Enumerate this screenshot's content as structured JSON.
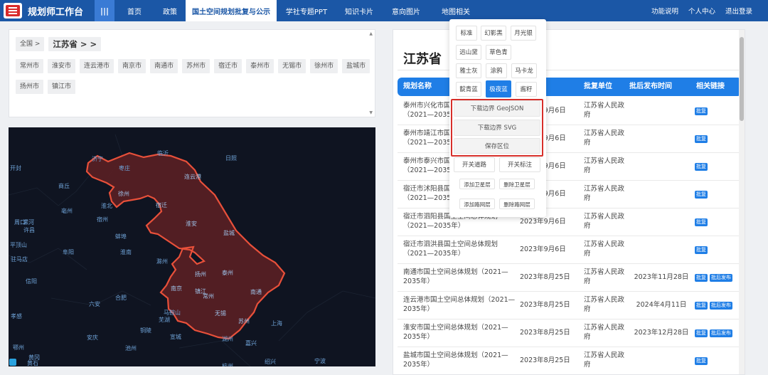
{
  "header": {
    "brand": "规划师工作台",
    "menu_toggle": "|||",
    "nav": [
      {
        "label": "首页",
        "active": false
      },
      {
        "label": "政策",
        "active": false
      },
      {
        "label": "国土空间规划批复与公示",
        "active": true
      },
      {
        "label": "学社专题PPT",
        "active": false
      },
      {
        "label": "知识卡片",
        "active": false
      },
      {
        "label": "意向图片",
        "active": false
      },
      {
        "label": "地图相关",
        "active": false
      }
    ],
    "right_links": [
      "功能说明",
      "个人中心",
      "退出登录"
    ]
  },
  "city_panel": {
    "crumb_all": "全国 >",
    "crumb_province": "江苏省 > >",
    "cities": [
      "常州市",
      "淮安市",
      "连云港市",
      "南京市",
      "南通市",
      "苏州市",
      "宿迁市",
      "泰州市",
      "无锡市",
      "徐州市",
      "盐城市",
      "扬州市",
      "镇江市"
    ]
  },
  "map": {
    "labels": [
      {
        "text": "济宁"
      },
      {
        "text": "临沂"
      },
      {
        "text": "枣庄"
      },
      {
        "text": "日照"
      },
      {
        "text": "开封"
      },
      {
        "text": "商丘"
      },
      {
        "text": "徐州"
      },
      {
        "text": "连云港"
      },
      {
        "text": "周口"
      },
      {
        "text": "亳州"
      },
      {
        "text": "淮北"
      },
      {
        "text": "宿州"
      },
      {
        "text": "宿迁"
      },
      {
        "text": "漯河"
      },
      {
        "text": "蚌埠"
      },
      {
        "text": "淮安"
      },
      {
        "text": "盐城"
      },
      {
        "text": "阜阳"
      },
      {
        "text": "淮南"
      },
      {
        "text": "滁州"
      },
      {
        "text": "扬州"
      },
      {
        "text": "泰州"
      },
      {
        "text": "信阳"
      },
      {
        "text": "六安"
      },
      {
        "text": "合肥"
      },
      {
        "text": "南京"
      },
      {
        "text": "镇江"
      },
      {
        "text": "常州"
      },
      {
        "text": "南通"
      },
      {
        "text": "马鞍山"
      },
      {
        "text": "芜湖"
      },
      {
        "text": "无锡"
      },
      {
        "text": "苏州"
      },
      {
        "text": "上海"
      },
      {
        "text": "安庆"
      },
      {
        "text": "铜陵"
      },
      {
        "text": "宣城"
      },
      {
        "text": "湖州"
      },
      {
        "text": "嘉兴"
      },
      {
        "text": "池州"
      },
      {
        "text": "黄冈"
      },
      {
        "text": "杭州"
      },
      {
        "text": "黄石"
      },
      {
        "text": "绍兴"
      },
      {
        "text": "鄂州"
      },
      {
        "text": "许昌"
      },
      {
        "text": "平顶山"
      },
      {
        "text": "驻马店"
      },
      {
        "text": "孝感"
      },
      {
        "text": "宁波"
      }
    ]
  },
  "detail": {
    "title": "江苏省",
    "columns": [
      "规划名称",
      "",
      "批复单位",
      "批后发布时间",
      "相关链接"
    ],
    "rows": [
      {
        "name": "泰州市兴化市国土空间总体规划（2021—2035年）",
        "date": "2023年9月6日",
        "unit": "江苏省人民政府",
        "pub": "",
        "links": [
          "批复"
        ]
      },
      {
        "name": "泰州市靖江市国土空间总体规划（2021—2035年）",
        "date": "2023年9月6日",
        "unit": "江苏省人民政府",
        "pub": "",
        "links": [
          "批复"
        ]
      },
      {
        "name": "泰州市泰兴市国土空间总体规划（2021—2035年）",
        "date": "2023年9月6日",
        "unit": "江苏省人民政府",
        "pub": "",
        "links": [
          "批复"
        ]
      },
      {
        "name": "宿迁市沭阳县国土空间总体规划（2021—2035年）",
        "date": "2023年9月6日",
        "unit": "江苏省人民政府",
        "pub": "",
        "links": [
          "批复"
        ]
      },
      {
        "name": "宿迁市泗阳县国土空间总体规划（2021—2035年）",
        "date": "2023年9月6日",
        "unit": "江苏省人民政府",
        "pub": "",
        "links": [
          "批复"
        ]
      },
      {
        "name": "宿迁市泗洪县国土空间总体规划（2021—2035年）",
        "date": "2023年9月6日",
        "unit": "江苏省人民政府",
        "pub": "",
        "links": [
          "批复"
        ]
      },
      {
        "name": "南通市国土空间总体规划（2021—2035年）",
        "date": "2023年8月25日",
        "unit": "江苏省人民政府",
        "pub": "2023年11月28日",
        "links": [
          "批复",
          "批后发布"
        ]
      },
      {
        "name": "连云港市国土空间总体规划（2021—2035年）",
        "date": "2023年8月25日",
        "unit": "江苏省人民政府",
        "pub": "2024年4月11日",
        "links": [
          "批复",
          "批后发布"
        ]
      },
      {
        "name": "淮安市国土空间总体规划（2021—2035年）",
        "date": "2023年8月25日",
        "unit": "江苏省人民政府",
        "pub": "2023年12月28日",
        "links": [
          "批复",
          "批后发布"
        ]
      },
      {
        "name": "盐城市国土空间总体规划（2021—2035年）",
        "date": "2023年8月25日",
        "unit": "江苏省人民政府",
        "pub": "",
        "links": [
          "批复"
        ]
      }
    ]
  },
  "popup": {
    "styles": [
      {
        "label": "标准",
        "active": false
      },
      {
        "label": "幻影黑",
        "active": false
      },
      {
        "label": "月光银",
        "active": false
      },
      {
        "label": "远山黛",
        "active": false
      },
      {
        "label": "草色青",
        "active": false
      },
      {
        "label": "雅士灰",
        "active": false
      },
      {
        "label": "涂鸦",
        "active": false
      },
      {
        "label": "马卡龙",
        "active": false
      },
      {
        "label": "靛青蓝",
        "active": false
      },
      {
        "label": "极夜蓝",
        "active": true
      },
      {
        "label": "酱籽",
        "active": false
      }
    ],
    "download_geojson": "下载边界 GeoJSON",
    "download_svg": "下载边界 SVG",
    "save_region": "保存区位",
    "toggle_roads": "开关道路",
    "toggle_labels": "开关标注",
    "add_satellite": "添加卫星层",
    "remove_satellite": "删除卫星层",
    "add_road": "添加路网层",
    "remove_road": "删除路网层"
  },
  "colors": {
    "nav": "#1b57a6",
    "accent": "#1f7ee6",
    "highlight": "#d72f2a",
    "region_fill": "#5a1f24",
    "region_stroke": "#e8503a"
  }
}
